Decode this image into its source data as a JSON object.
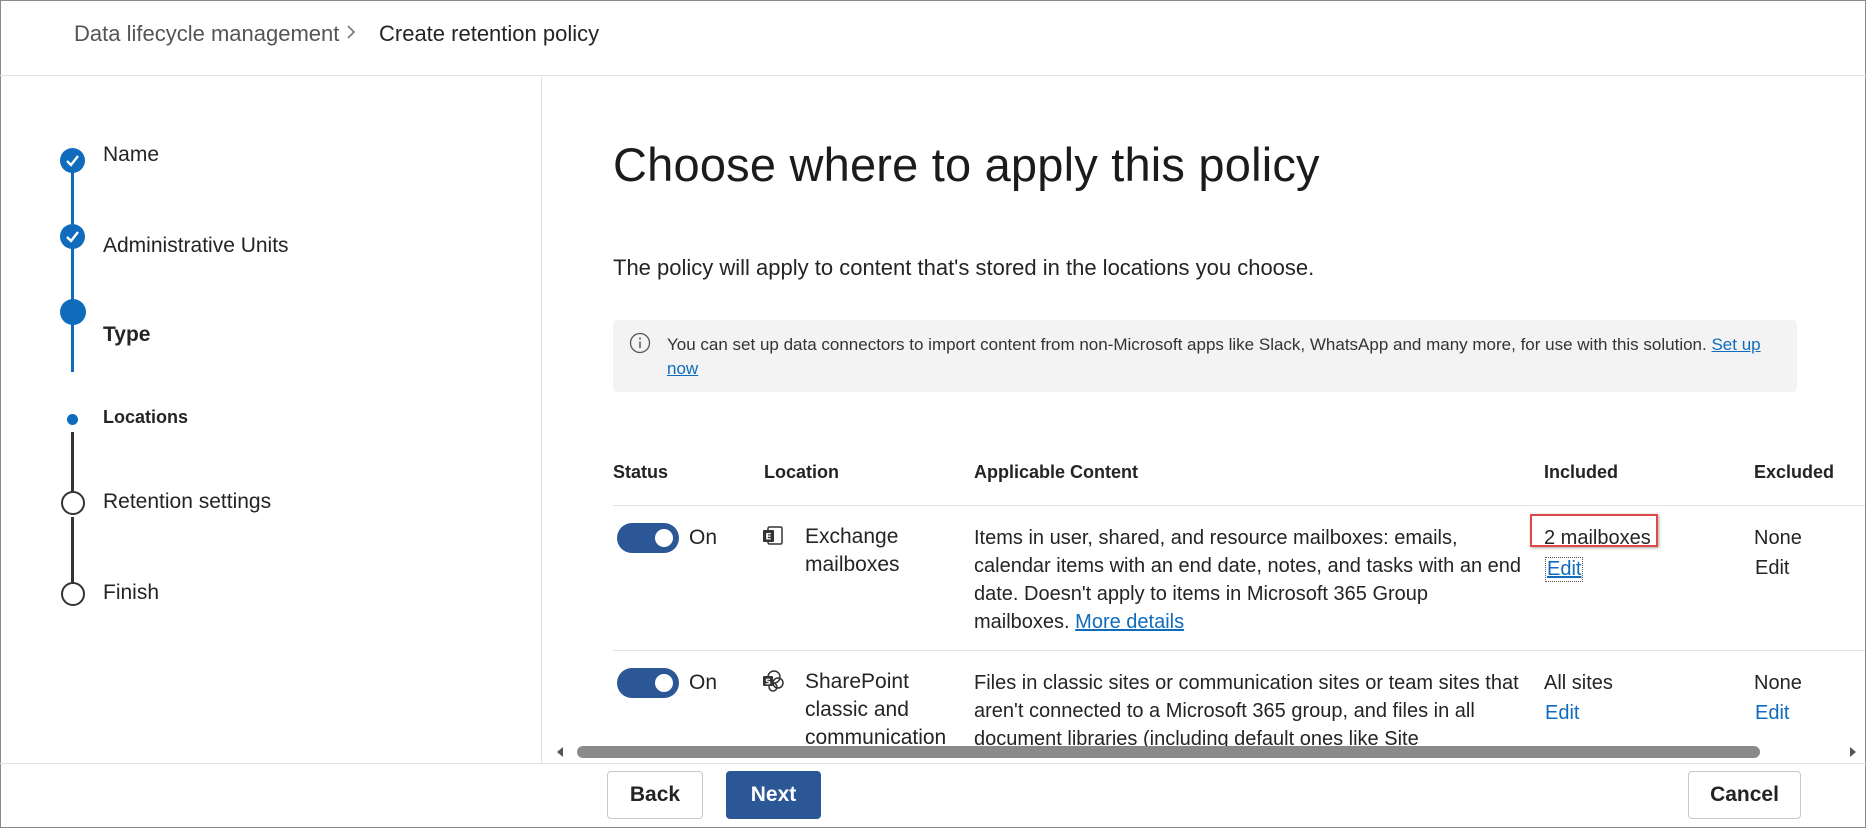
{
  "breadcrumb": {
    "root": "Data lifecycle management",
    "current": "Create retention policy"
  },
  "steps": [
    {
      "label": "Name",
      "state": "completed"
    },
    {
      "label": "Administrative Units",
      "state": "completed"
    },
    {
      "label": "Type",
      "state": "current"
    },
    {
      "label": "Locations",
      "state": "current-substep"
    },
    {
      "label": "Retention settings",
      "state": "pending"
    },
    {
      "label": "Finish",
      "state": "pending"
    }
  ],
  "main": {
    "title": "Choose where to apply this policy",
    "description": "The policy will apply to content that's stored in the locations you choose.",
    "info": {
      "text": "You can set up data connectors to import content from non-Microsoft apps like Slack, WhatsApp and many more, for use with this solution.",
      "link": "Set up now",
      "icon": "info-icon"
    }
  },
  "table": {
    "headers": {
      "status": "Status",
      "location": "Location",
      "content": "Applicable Content",
      "included": "Included",
      "excluded": "Excluded"
    },
    "rows": [
      {
        "status": "On",
        "toggle_on": true,
        "location_icon": "exchange-icon",
        "location": "Exchange mailboxes",
        "content": "Items in user, shared, and resource mailboxes: emails, calendar items with an end date, notes, and tasks with an end date. Doesn't apply to items in Microsoft 365 Group mailboxes.",
        "content_link": "More details",
        "included": "2 mailboxes",
        "included_edit": "Edit",
        "excluded": "None",
        "excluded_edit": "Edit"
      },
      {
        "status": "On",
        "toggle_on": true,
        "location_icon": "sharepoint-icon",
        "location": "SharePoint classic and communication",
        "content": "Files in classic sites or communication sites or team sites that aren't connected to a Microsoft 365 group, and files in all document libraries (including default ones like Site",
        "included": "All sites",
        "included_edit": "Edit",
        "excluded": "None",
        "excluded_edit": "Edit"
      }
    ]
  },
  "footer": {
    "back": "Back",
    "next": "Next",
    "cancel": "Cancel"
  },
  "colors": {
    "accent": "#2b5797",
    "link": "#0f6cbd",
    "step_active": "#0f6cbd",
    "highlight": "#e04848"
  }
}
